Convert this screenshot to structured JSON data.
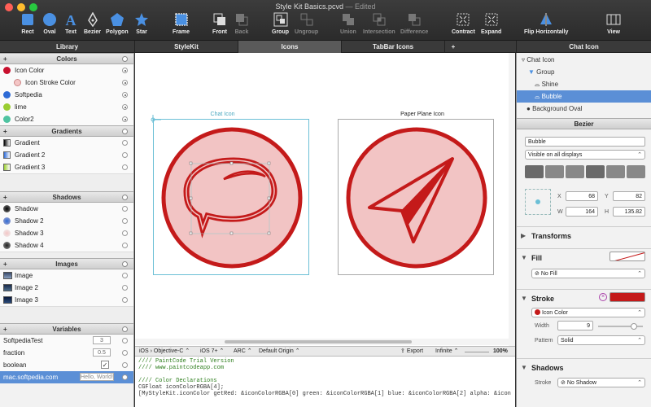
{
  "window": {
    "title": "Style Kit Basics.pcvd",
    "edited": "— Edited"
  },
  "toolbar": {
    "rect": "Rect",
    "oval": "Oval",
    "text": "Text",
    "bezier": "Bezier",
    "polygon": "Polygon",
    "star": "Star",
    "frame": "Frame",
    "front": "Front",
    "back": "Back",
    "group": "Group",
    "ungroup": "Ungroup",
    "union": "Union",
    "intersection": "Intersection",
    "difference": "Difference",
    "contract": "Contract",
    "expand": "Expand",
    "flip_horizontally": "Flip Horizontally",
    "view": "View"
  },
  "tabs": {
    "library": "Library",
    "stylekit": "StyleKit",
    "icons": "Icons",
    "tabbar_icons": "TabBar Icons",
    "add": "+",
    "chat_icon": "Chat Icon"
  },
  "library": {
    "colors_title": "Colors",
    "colors": [
      {
        "name": "Icon Color",
        "color": "#c8102e"
      },
      {
        "name": "Icon Stroke Color",
        "color": "#f4c6c6"
      },
      {
        "name": "Softpedia",
        "color": "#2e6bd6"
      },
      {
        "name": "lime",
        "color": "#9acd32"
      },
      {
        "name": "Color2",
        "color": "#4fc3a1"
      }
    ],
    "gradients_title": "Gradients",
    "gradients": [
      "Gradient",
      "Gradient 2",
      "Gradient 3"
    ],
    "shadows_title": "Shadows",
    "shadows": [
      "Shadow",
      "Shadow 2",
      "Shadow 3",
      "Shadow 4"
    ],
    "images_title": "Images",
    "images": [
      "Image",
      "Image 2",
      "Image 3"
    ],
    "variables_title": "Variables",
    "variables": [
      {
        "name": "SoftpediaTest",
        "value": "3"
      },
      {
        "name": "fraction",
        "value": "0.5"
      },
      {
        "name": "boolean",
        "value": ""
      },
      {
        "name": "mac.softpedia.com",
        "value": "Hello, World!"
      }
    ]
  },
  "canvas": {
    "chat_label": "Chat Icon",
    "plane_label": "Paper Plane Icon"
  },
  "codebar": {
    "platform": "iOS › Objective-C",
    "ios": "iOS 7+",
    "arc": "ARC",
    "origin": "Default Origin",
    "export": "Export",
    "infinite": "Infinite",
    "zoom": "100%"
  },
  "code": {
    "line1": "//// PaintCode Trial Version",
    "line2": "//// www.paintcodeapp.com",
    "line3": "",
    "line4": "//// Color Declarations",
    "line5": "CGFloat iconColorRGBA[4];",
    "line6": "[MyStyleKit.iconColor getRed: &iconColorRGBA[0] green: &iconColorRGBA[1] blue: &iconColorRGBA[2] alpha: &icon"
  },
  "inspector": {
    "tree": [
      "Chat Icon",
      "Group",
      "Shine",
      "Bubble",
      "Background Oval"
    ],
    "bezier_title": "Bezier",
    "name_value": "Bubble",
    "visibility": "Visible on all displays",
    "x_label": "X",
    "x_value": "68",
    "y_label": "Y",
    "y_value": "82",
    "w_label": "W",
    "w_value": "164",
    "h_label": "H",
    "h_value": "135.82",
    "transforms": "Transforms",
    "fill": "Fill",
    "fill_value": "No Fill",
    "stroke": "Stroke",
    "stroke_color": "Icon Color",
    "width_label": "Width",
    "width_value": "9",
    "pattern_label": "Pattern",
    "pattern_value": "Solid",
    "shadows": "Shadows",
    "shadow_stroke_label": "Stroke",
    "shadow_value": "No Shadow"
  },
  "colors": {
    "icon_red": "#c41a1a",
    "icon_fill": "#f2c4c4",
    "selection": "#5b8fd6",
    "artboard_select": "#6bbfd6"
  }
}
